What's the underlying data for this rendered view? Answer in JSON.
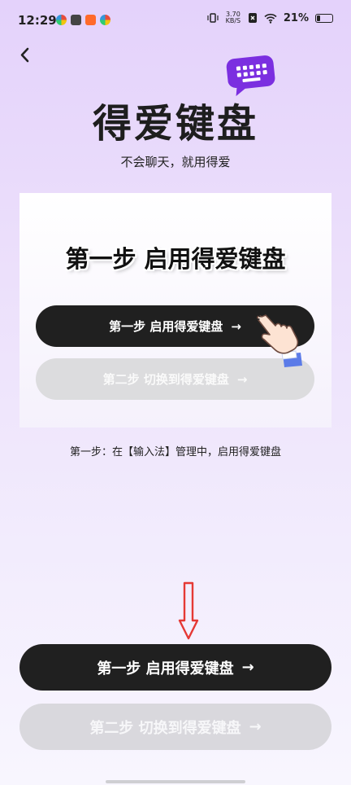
{
  "status_bar": {
    "time": "12:29",
    "net_speed_value": "3.70",
    "net_speed_unit": "KB/S",
    "battery": "21%"
  },
  "app": {
    "title": "得爱键盘",
    "subtitle": "不会聊天，就用得爱"
  },
  "preview": {
    "heading": "第一步 启用得爱键盘",
    "step1_label": "第一步 启用得爱键盘",
    "step2_label": "第二步 切换到得爱键盘",
    "arrow": "→"
  },
  "instruction": "第一步：在【输入法】管理中，启用得爱键盘",
  "actions": {
    "step1_label": "第一步 启用得爱键盘",
    "step2_label": "第二步 切换到得爱键盘",
    "arrow": "→"
  },
  "colors": {
    "accent": "#7b2fe0",
    "button_dark": "#202020",
    "button_disabled": "#d9d8dd",
    "hint_arrow": "#e53935"
  }
}
